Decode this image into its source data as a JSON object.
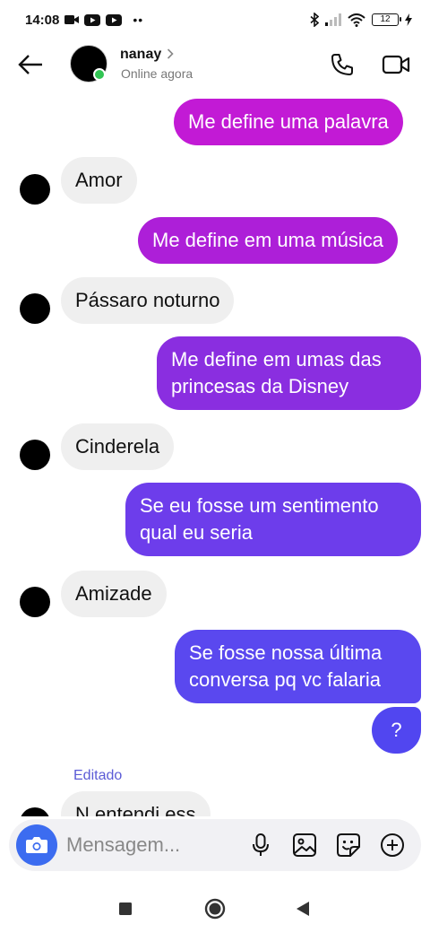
{
  "status_bar": {
    "time": "14:08",
    "extra": "••",
    "battery": "12"
  },
  "header": {
    "name": "nanay​",
    "status": "Online agora"
  },
  "messages": [
    {
      "side": "sent",
      "text": "Me define uma palavra"
    },
    {
      "side": "recv",
      "text": "Amor"
    },
    {
      "side": "sent",
      "text": "Me define em uma música"
    },
    {
      "side": "recv",
      "text": "Pássaro noturno"
    },
    {
      "side": "sent",
      "text": "Me define em umas das princesas da Disney"
    },
    {
      "side": "recv",
      "text": "Cinderela"
    },
    {
      "side": "sent",
      "text": "Se eu fosse um sentimento qual eu seria"
    },
    {
      "side": "recv",
      "text": "Amizade"
    },
    {
      "side": "sent",
      "text": "Se fosse nossa última conversa pq vc falaria"
    },
    {
      "side": "sent",
      "text": "?"
    },
    {
      "side": "recv",
      "text": "N entendi ess",
      "edited_label": "Editado"
    }
  ],
  "composer": {
    "placeholder": "Mensagem..."
  },
  "colors": {
    "sent_gradient_top": "#c21fd4",
    "sent_gradient_bottom": "#5a4cf0",
    "online_dot": "#31c553",
    "camera_button": "#3c6cf0",
    "edited_label": "#5b5bd6"
  }
}
